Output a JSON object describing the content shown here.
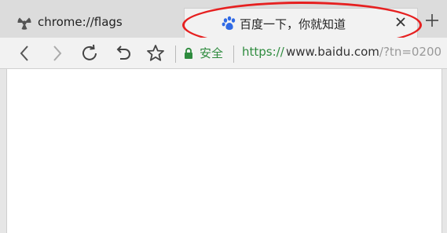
{
  "tabs": {
    "inactive": {
      "title": "chrome://flags",
      "icon": "radiation-icon"
    },
    "active": {
      "title": "百度一下，你就知道",
      "icon": "baidu-paw-icon"
    }
  },
  "newtab": {
    "icon": "plus-icon"
  },
  "toolbar": {
    "back_icon": "back-icon",
    "forward_icon": "forward-icon",
    "reload_icon": "reload-icon",
    "undo_icon": "undo-icon",
    "star_icon": "star-icon"
  },
  "address": {
    "secure_label": "安全",
    "url_scheme": "https://",
    "url_host": "www.baidu.com",
    "url_tail": "/?tn=0200"
  },
  "colors": {
    "secure_green": "#2e8b3e",
    "baidu_blue": "#2f6ae5",
    "annotation_red": "#e62020"
  }
}
